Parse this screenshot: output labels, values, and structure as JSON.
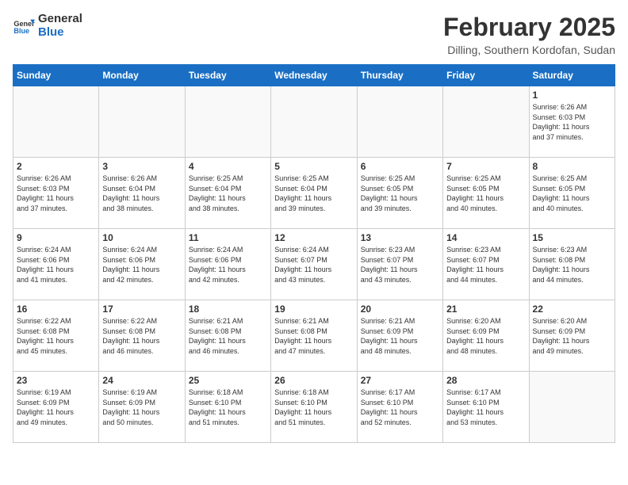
{
  "logo": {
    "line1": "General",
    "line2": "Blue"
  },
  "title": "February 2025",
  "subtitle": "Dilling, Southern Kordofan, Sudan",
  "days_of_week": [
    "Sunday",
    "Monday",
    "Tuesday",
    "Wednesday",
    "Thursday",
    "Friday",
    "Saturday"
  ],
  "weeks": [
    [
      {
        "day": "",
        "info": ""
      },
      {
        "day": "",
        "info": ""
      },
      {
        "day": "",
        "info": ""
      },
      {
        "day": "",
        "info": ""
      },
      {
        "day": "",
        "info": ""
      },
      {
        "day": "",
        "info": ""
      },
      {
        "day": "1",
        "info": "Sunrise: 6:26 AM\nSunset: 6:03 PM\nDaylight: 11 hours\nand 37 minutes."
      }
    ],
    [
      {
        "day": "2",
        "info": "Sunrise: 6:26 AM\nSunset: 6:03 PM\nDaylight: 11 hours\nand 37 minutes."
      },
      {
        "day": "3",
        "info": "Sunrise: 6:26 AM\nSunset: 6:04 PM\nDaylight: 11 hours\nand 38 minutes."
      },
      {
        "day": "4",
        "info": "Sunrise: 6:25 AM\nSunset: 6:04 PM\nDaylight: 11 hours\nand 38 minutes."
      },
      {
        "day": "5",
        "info": "Sunrise: 6:25 AM\nSunset: 6:04 PM\nDaylight: 11 hours\nand 39 minutes."
      },
      {
        "day": "6",
        "info": "Sunrise: 6:25 AM\nSunset: 6:05 PM\nDaylight: 11 hours\nand 39 minutes."
      },
      {
        "day": "7",
        "info": "Sunrise: 6:25 AM\nSunset: 6:05 PM\nDaylight: 11 hours\nand 40 minutes."
      },
      {
        "day": "8",
        "info": "Sunrise: 6:25 AM\nSunset: 6:05 PM\nDaylight: 11 hours\nand 40 minutes."
      }
    ],
    [
      {
        "day": "9",
        "info": "Sunrise: 6:24 AM\nSunset: 6:06 PM\nDaylight: 11 hours\nand 41 minutes."
      },
      {
        "day": "10",
        "info": "Sunrise: 6:24 AM\nSunset: 6:06 PM\nDaylight: 11 hours\nand 42 minutes."
      },
      {
        "day": "11",
        "info": "Sunrise: 6:24 AM\nSunset: 6:06 PM\nDaylight: 11 hours\nand 42 minutes."
      },
      {
        "day": "12",
        "info": "Sunrise: 6:24 AM\nSunset: 6:07 PM\nDaylight: 11 hours\nand 43 minutes."
      },
      {
        "day": "13",
        "info": "Sunrise: 6:23 AM\nSunset: 6:07 PM\nDaylight: 11 hours\nand 43 minutes."
      },
      {
        "day": "14",
        "info": "Sunrise: 6:23 AM\nSunset: 6:07 PM\nDaylight: 11 hours\nand 44 minutes."
      },
      {
        "day": "15",
        "info": "Sunrise: 6:23 AM\nSunset: 6:08 PM\nDaylight: 11 hours\nand 44 minutes."
      }
    ],
    [
      {
        "day": "16",
        "info": "Sunrise: 6:22 AM\nSunset: 6:08 PM\nDaylight: 11 hours\nand 45 minutes."
      },
      {
        "day": "17",
        "info": "Sunrise: 6:22 AM\nSunset: 6:08 PM\nDaylight: 11 hours\nand 46 minutes."
      },
      {
        "day": "18",
        "info": "Sunrise: 6:21 AM\nSunset: 6:08 PM\nDaylight: 11 hours\nand 46 minutes."
      },
      {
        "day": "19",
        "info": "Sunrise: 6:21 AM\nSunset: 6:08 PM\nDaylight: 11 hours\nand 47 minutes."
      },
      {
        "day": "20",
        "info": "Sunrise: 6:21 AM\nSunset: 6:09 PM\nDaylight: 11 hours\nand 48 minutes."
      },
      {
        "day": "21",
        "info": "Sunrise: 6:20 AM\nSunset: 6:09 PM\nDaylight: 11 hours\nand 48 minutes."
      },
      {
        "day": "22",
        "info": "Sunrise: 6:20 AM\nSunset: 6:09 PM\nDaylight: 11 hours\nand 49 minutes."
      }
    ],
    [
      {
        "day": "23",
        "info": "Sunrise: 6:19 AM\nSunset: 6:09 PM\nDaylight: 11 hours\nand 49 minutes."
      },
      {
        "day": "24",
        "info": "Sunrise: 6:19 AM\nSunset: 6:09 PM\nDaylight: 11 hours\nand 50 minutes."
      },
      {
        "day": "25",
        "info": "Sunrise: 6:18 AM\nSunset: 6:10 PM\nDaylight: 11 hours\nand 51 minutes."
      },
      {
        "day": "26",
        "info": "Sunrise: 6:18 AM\nSunset: 6:10 PM\nDaylight: 11 hours\nand 51 minutes."
      },
      {
        "day": "27",
        "info": "Sunrise: 6:17 AM\nSunset: 6:10 PM\nDaylight: 11 hours\nand 52 minutes."
      },
      {
        "day": "28",
        "info": "Sunrise: 6:17 AM\nSunset: 6:10 PM\nDaylight: 11 hours\nand 53 minutes."
      },
      {
        "day": "",
        "info": ""
      }
    ]
  ]
}
